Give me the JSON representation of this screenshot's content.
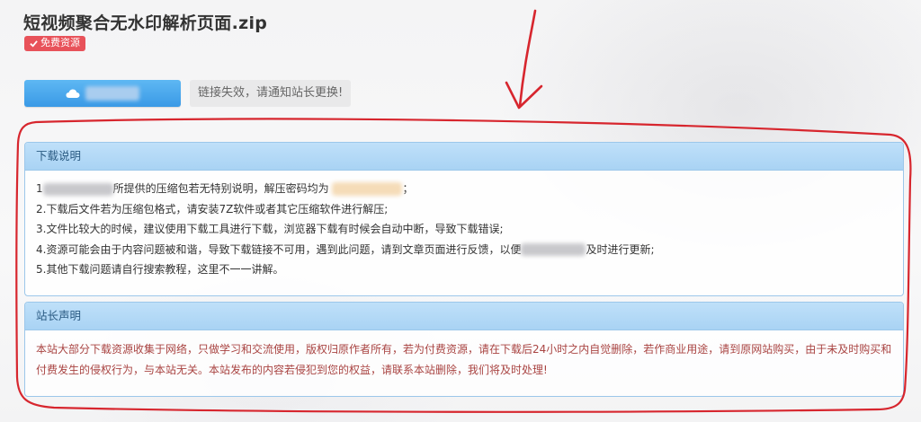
{
  "page_title": "短视频聚合无水印解析页面.zip",
  "badge": {
    "label": "免费资源",
    "icon": "check-icon",
    "color": "#e8525a"
  },
  "download_button": {
    "icon": "cloud-icon",
    "label": ""
  },
  "link_notice": "链接失效，请通知站长更换!",
  "annotation": {
    "color": "#d7262e",
    "shapes": [
      "arrow",
      "rounded-outline"
    ]
  },
  "download_panel": {
    "title": "下载说明",
    "items": [
      {
        "prefix": "1",
        "text": "所提供的压缩包若无特别说明，解压密码均为",
        "suffix": "；"
      },
      {
        "text": "2.下载后文件若为压缩包格式，请安装7Z软件或者其它压缩软件进行解压;"
      },
      {
        "text": "3.文件比较大的时候，建议使用下载工具进行下载，浏览器下载有时候会自动中断，导致下载错误;"
      },
      {
        "prefix": "4.资源可能会由于内容问题被和谐，导致下载链接不可用，遇到此问题，请到文章页面进行反馈，以便",
        "suffix": "及时进行更新;"
      },
      {
        "text": "5.其他下载问题请自行搜索教程，这里不一一讲解。"
      }
    ]
  },
  "statement_panel": {
    "title": "站长声明",
    "text": "本站大部分下载资源收集于网络，只做学习和交流使用，版权归原作者所有，若为付费资源，请在下载后24小时之内自觉删除，若作商业用途，请到原网站购买，由于未及时购买和付费发生的侵权行为，与本站无关。本站发布的内容若侵犯到您的权益，请联系本站删除，我们将及时处理!"
  }
}
